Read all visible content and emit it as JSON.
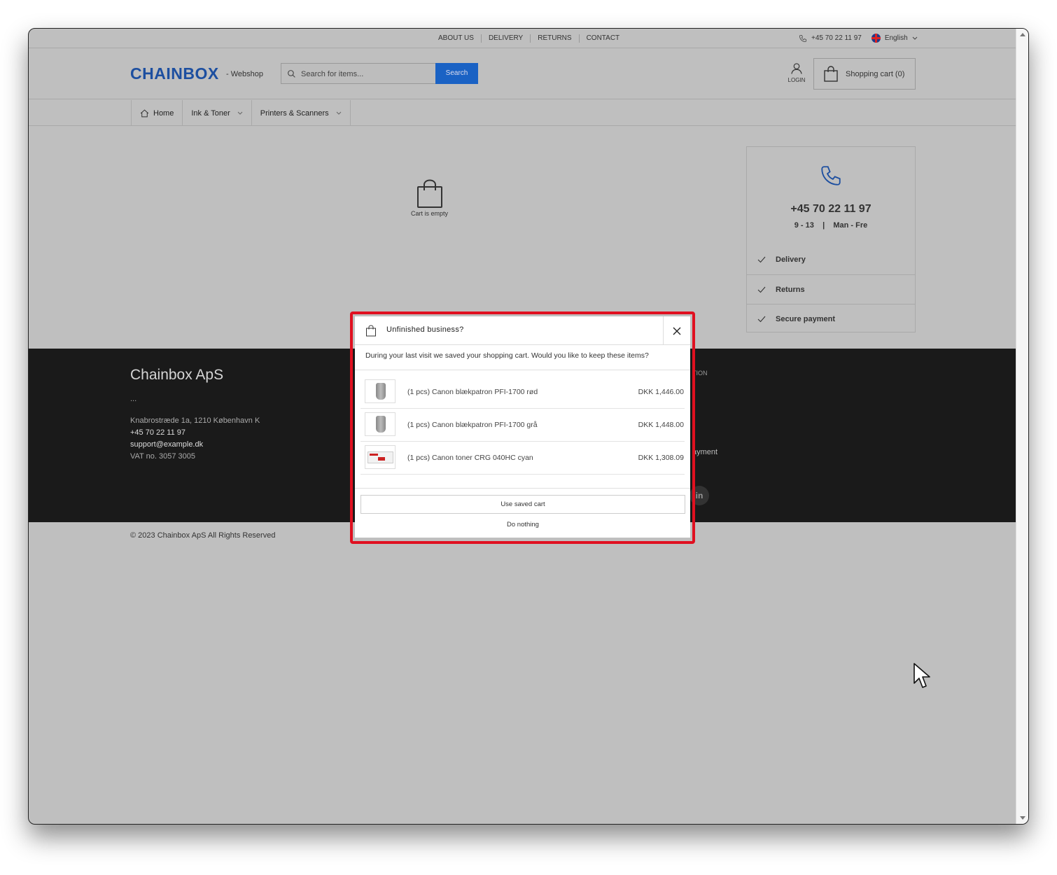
{
  "topbar": {
    "links": [
      "ABOUT US",
      "DELIVERY",
      "RETURNS",
      "CONTACT"
    ],
    "phone": "+45 70 22 11 97",
    "language": "English"
  },
  "header": {
    "logo": "CHAINBOX",
    "tagline": "- Webshop",
    "search_placeholder": "Search for items...",
    "search_button": "Search",
    "login_label": "LOGIN",
    "cart_label": "Shopping cart (0)"
  },
  "nav": {
    "items": [
      {
        "label": "Home",
        "icon": "home-icon"
      },
      {
        "label": "Ink & Toner",
        "icon": "chevron-down-icon"
      },
      {
        "label": "Printers & Scanners",
        "icon": "chevron-down-icon"
      }
    ]
  },
  "main": {
    "empty_cart_text": "Cart is empty"
  },
  "sidebar": {
    "phone": "+45 70 22 11 97",
    "hours": "9 - 13    |    Man - Fre",
    "features": [
      "Delivery",
      "Returns",
      "Secure payment"
    ]
  },
  "footer": {
    "company": "Chainbox ApS",
    "dots": "...",
    "address": "Knabrostræde 1a, 1210 København K",
    "phone": "+45 70 22 11 97",
    "email": "support@example.dk",
    "vat": "VAT no. 3057 3005",
    "right_heading_fragment": "TION",
    "right_link_fragment": "ayment",
    "social": "in",
    "copyright": "© 2023 Chainbox ApS All Rights Reserved"
  },
  "modal": {
    "title": "Unfinished business?",
    "message": "During your last visit we saved your shopping cart. Would you like to keep these items?",
    "items": [
      {
        "name": "(1 pcs) Canon blækpatron PFI-1700 rød",
        "price": "DKK 1,446.00",
        "thumb": "ink-cartridge"
      },
      {
        "name": "(1 pcs) Canon blækpatron PFI-1700 grå",
        "price": "DKK 1,448.00",
        "thumb": "ink-cartridge"
      },
      {
        "name": "(1 pcs) Canon toner CRG 040HC cyan",
        "price": "DKK 1,308.09",
        "thumb": "toner-box"
      }
    ],
    "use_button": "Use saved cart",
    "nothing_button": "Do nothing",
    "highlight_color": "#e01020"
  },
  "colors": {
    "brand": "#1d4fa0",
    "search_button": "#1a62c4",
    "overlay": "#bfbfbf",
    "footer_bg": "#1a1a1a"
  }
}
